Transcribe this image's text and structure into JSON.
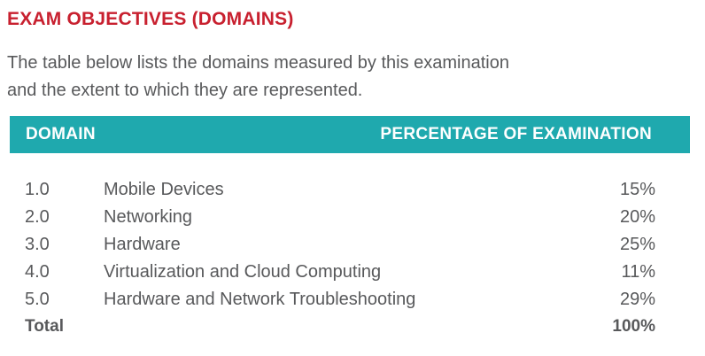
{
  "heading": "EXAM OBJECTIVES (DOMAINS)",
  "intro": {
    "line1": "The table below lists the domains measured by this examination",
    "line2": "and the extent to which they are represented."
  },
  "table": {
    "header": {
      "domain": "DOMAIN",
      "percentage": "PERCENTAGE OF EXAMINATION"
    },
    "rows": [
      {
        "number": "1.0",
        "name": "Mobile Devices",
        "percent": "15%"
      },
      {
        "number": "2.0",
        "name": "Networking",
        "percent": "20%"
      },
      {
        "number": "3.0",
        "name": "Hardware",
        "percent": "25%"
      },
      {
        "number": "4.0",
        "name": "Virtualization and Cloud Computing",
        "percent": "11%"
      },
      {
        "number": "5.0",
        "name": "Hardware and Network Troubleshooting",
        "percent": "29%"
      }
    ],
    "total": {
      "label": "Total",
      "percent": "100%"
    }
  },
  "colors": {
    "heading": "#c8202f",
    "header_bar": "#1fa9ae",
    "body_text": "#58595b"
  }
}
